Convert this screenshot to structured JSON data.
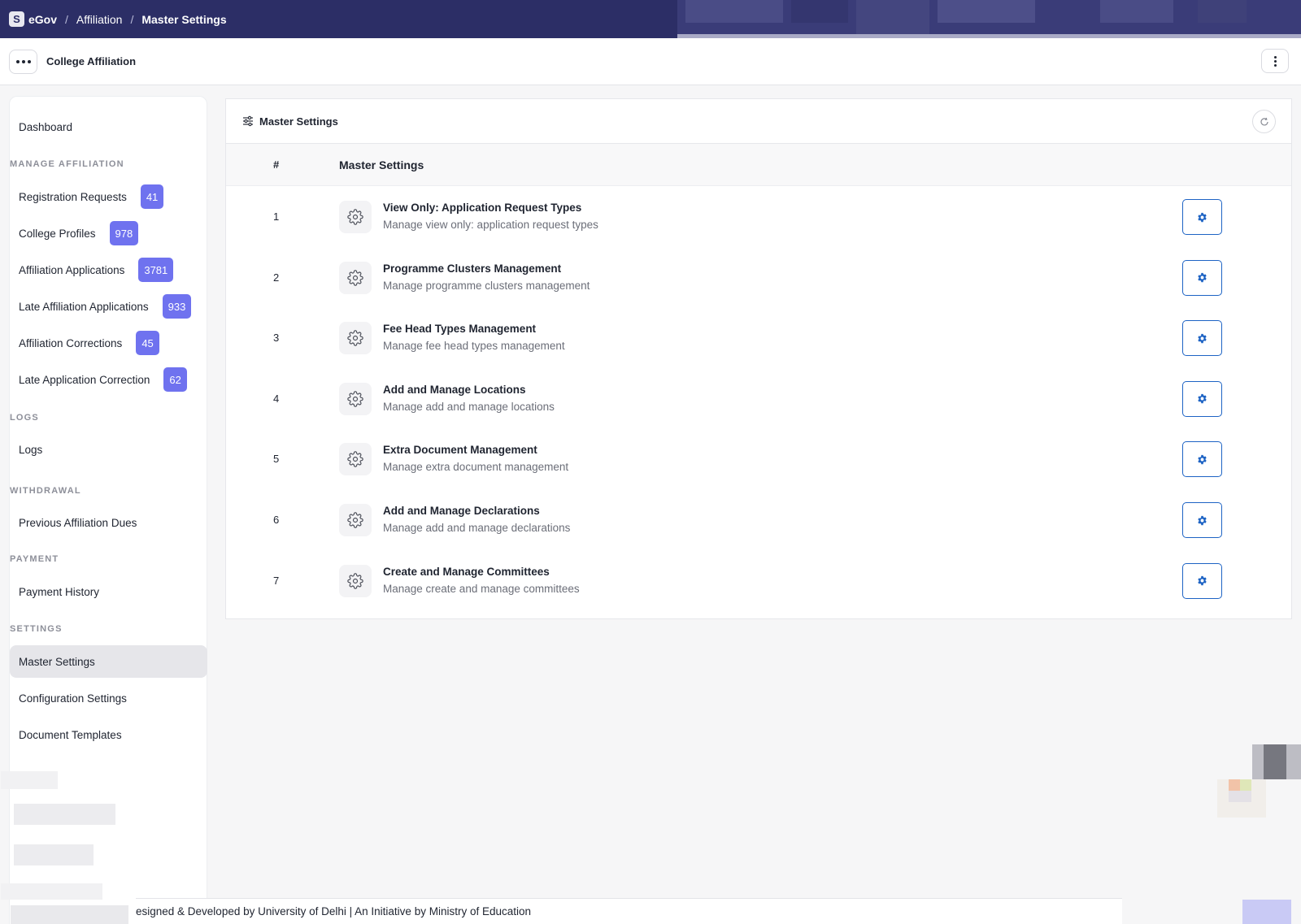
{
  "topbar": {
    "logo_letter": "S",
    "brand": "eGov",
    "breadcrumbs": [
      "Affiliation",
      "Master Settings"
    ],
    "separator": "/"
  },
  "subheader": {
    "app_title": "College Affiliation"
  },
  "sidebar": {
    "items": [
      {
        "label": "Dashboard"
      },
      {
        "section": "MANAGE AFFILIATION"
      },
      {
        "label": "Registration Requests",
        "badge": "41"
      },
      {
        "label": "College Profiles",
        "badge": "978"
      },
      {
        "label": "Affiliation Applications",
        "badge": "3781"
      },
      {
        "label": "Late Affiliation Applications",
        "badge": "933"
      },
      {
        "label": "Affiliation Corrections",
        "badge": "45"
      },
      {
        "label": "Late Application Correction",
        "badge": "62"
      },
      {
        "section": "LOGS"
      },
      {
        "label": "Logs"
      },
      {
        "section": "WITHDRAWAL"
      },
      {
        "label": "Previous Affiliation Dues"
      },
      {
        "section": "PAYMENT"
      },
      {
        "label": "Payment History"
      },
      {
        "section": "SETTINGS"
      },
      {
        "label": "Master Settings",
        "active": true
      },
      {
        "label": "Configuration Settings"
      },
      {
        "label": "Document Templates"
      }
    ],
    "badge_color": "#6f72ef"
  },
  "panel": {
    "title": "Master Settings",
    "columns": {
      "num": "#",
      "title": "Master Settings"
    },
    "rows": [
      {
        "num": "1",
        "title": "View Only: Application Request Types",
        "desc": "Manage view only: application request types"
      },
      {
        "num": "2",
        "title": "Programme Clusters Management",
        "desc": "Manage programme clusters management"
      },
      {
        "num": "3",
        "title": "Fee Head Types Management",
        "desc": "Manage fee head types management"
      },
      {
        "num": "4",
        "title": "Add and Manage Locations",
        "desc": "Manage add and manage locations"
      },
      {
        "num": "5",
        "title": "Extra Document Management",
        "desc": "Manage extra document management"
      },
      {
        "num": "6",
        "title": "Add and Manage Declarations",
        "desc": "Manage add and manage declarations"
      },
      {
        "num": "7",
        "title": "Create and Manage Committees",
        "desc": "Manage create and manage committees"
      }
    ]
  },
  "footer": {
    "text": "esigned & Developed by University of Delhi | An Initiative by Ministry of Education"
  },
  "colors": {
    "topbar": "#2c2e66",
    "accent_blue": "#1d63c4"
  },
  "icons": {
    "panel": "sliders-icon",
    "refresh": "refresh-icon",
    "row": "gear-icon",
    "action": "cog-solid-icon"
  }
}
